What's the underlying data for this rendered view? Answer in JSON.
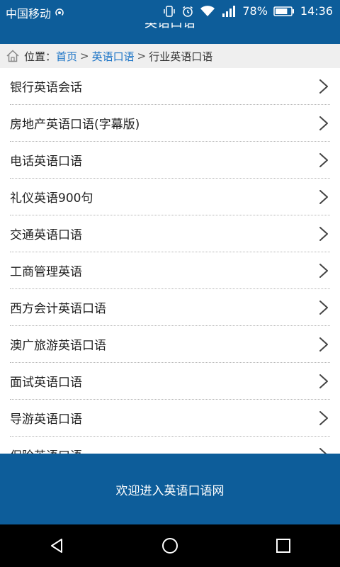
{
  "status_bar": {
    "carrier": "中国移动",
    "battery_percent": "78%",
    "time": "14:36",
    "icons": [
      "hotspot-icon",
      "vibrate-icon",
      "alarm-icon",
      "wifi-icon",
      "signal-icon",
      "battery-icon"
    ],
    "battery_level": 0.78
  },
  "app_header": {
    "title": "英语口语"
  },
  "breadcrumb": {
    "prefix": "位置：",
    "home": "首页",
    "sep1": ">",
    "category": "英语口语",
    "sep2": ">",
    "current": "行业英语口语"
  },
  "list": {
    "items": [
      {
        "label": "银行英语会话"
      },
      {
        "label": "房地产英语口语(字幕版)"
      },
      {
        "label": "电话英语口语"
      },
      {
        "label": "礼仪英语900句"
      },
      {
        "label": "交通英语口语"
      },
      {
        "label": "工商管理英语"
      },
      {
        "label": "西方会计英语口语"
      },
      {
        "label": "澳广旅游英语口语"
      },
      {
        "label": "面试英语口语"
      },
      {
        "label": "导游英语口语"
      },
      {
        "label": "保险英语口语"
      }
    ]
  },
  "footer": {
    "text": "欢迎进入英语口语网"
  },
  "nav_bar": {
    "buttons": [
      "back-icon",
      "home-circle-icon",
      "recents-icon"
    ]
  },
  "colors": {
    "primary": "#0d5d9a",
    "link": "#1a73c6",
    "breadcrumb_bg": "#efefef"
  }
}
